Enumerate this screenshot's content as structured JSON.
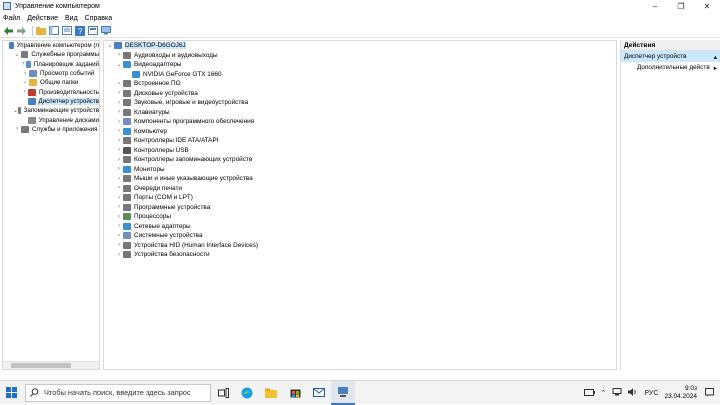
{
  "window": {
    "title": "Управление компьютером",
    "controls": [
      "–",
      "❐",
      "✕"
    ]
  },
  "menu": [
    "Файл",
    "Действие",
    "Вид",
    "Справка"
  ],
  "left_tree": [
    {
      "label": "Управление компьютером (л",
      "level": 0,
      "exp": "",
      "icon": "#4a7fbf"
    },
    {
      "label": "Служебные программы",
      "level": 1,
      "exp": "⌄",
      "icon": "#7a7a7a"
    },
    {
      "label": "Планировщик заданий",
      "level": 2,
      "exp": "›",
      "icon": "#5b8fd0"
    },
    {
      "label": "Просмотр событий",
      "level": 2,
      "exp": "›",
      "icon": "#6f8fbf"
    },
    {
      "label": "Общие папки",
      "level": 2,
      "exp": "›",
      "icon": "#e3b440"
    },
    {
      "label": "Производительность",
      "level": 2,
      "exp": "›",
      "icon": "#c0392b"
    },
    {
      "label": "Диспетчер устройств",
      "level": 2,
      "exp": "",
      "icon": "#4a7fbf",
      "selected": true
    },
    {
      "label": "Запоминающие устройств",
      "level": 1,
      "exp": "⌄",
      "icon": "#7a7a7a"
    },
    {
      "label": "Управление дисками",
      "level": 2,
      "exp": "",
      "icon": "#8a8a8a"
    },
    {
      "label": "Службы и приложения",
      "level": 1,
      "exp": "›",
      "icon": "#7a7a7a"
    }
  ],
  "device_tree": [
    {
      "label": "DESKTOP-D6GOJ6J",
      "level": 0,
      "exp": "⌄",
      "icon": "#4a7fbf",
      "selected": true
    },
    {
      "label": "Аудиовходы и аудиовыходы",
      "level": 1,
      "exp": "›",
      "icon": "#777777"
    },
    {
      "label": "Видеоадаптеры",
      "level": 1,
      "exp": "⌄",
      "icon": "#3a8fd0"
    },
    {
      "label": "NVIDIA GeForce GTX 1660",
      "level": 2,
      "exp": "",
      "icon": "#3a8fd0"
    },
    {
      "label": "Встроенное ПО",
      "level": 1,
      "exp": "›",
      "icon": "#777777"
    },
    {
      "label": "Дисковые устройства",
      "level": 1,
      "exp": "›",
      "icon": "#777777"
    },
    {
      "label": "Звуковые, игровые и видеоустройства",
      "level": 1,
      "exp": "›",
      "icon": "#777777"
    },
    {
      "label": "Клавиатуры",
      "level": 1,
      "exp": "›",
      "icon": "#777777"
    },
    {
      "label": "Компоненты программного обеспечения",
      "level": 1,
      "exp": "›",
      "icon": "#6f8fbf"
    },
    {
      "label": "Компьютер",
      "level": 1,
      "exp": "›",
      "icon": "#3a8fd0"
    },
    {
      "label": "Контроллеры IDE ATA/ATAPI",
      "level": 1,
      "exp": "›",
      "icon": "#777777"
    },
    {
      "label": "Контроллеры USB",
      "level": 1,
      "exp": "›",
      "icon": "#555555"
    },
    {
      "label": "Контроллеры запоминающих устройств",
      "level": 1,
      "exp": "›",
      "icon": "#777777"
    },
    {
      "label": "Мониторы",
      "level": 1,
      "exp": "›",
      "icon": "#3a8fd0"
    },
    {
      "label": "Мыши и иные указывающие устройства",
      "level": 1,
      "exp": "›",
      "icon": "#777777"
    },
    {
      "label": "Очереди печати",
      "level": 1,
      "exp": "›",
      "icon": "#777777"
    },
    {
      "label": "Порты (COM и LPT)",
      "level": 1,
      "exp": "›",
      "icon": "#777777"
    },
    {
      "label": "Программные устройства",
      "level": 1,
      "exp": "›",
      "icon": "#777777"
    },
    {
      "label": "Процессоры",
      "level": 1,
      "exp": "›",
      "icon": "#5a8f5a"
    },
    {
      "label": "Сетевые адаптеры",
      "level": 1,
      "exp": "›",
      "icon": "#3a8fd0"
    },
    {
      "label": "Системные устройства",
      "level": 1,
      "exp": "›",
      "icon": "#6f8fbf"
    },
    {
      "label": "Устройства HID (Human Interface Devices)",
      "level": 1,
      "exp": "›",
      "icon": "#777777"
    },
    {
      "label": "Устройства безопасности",
      "level": 1,
      "exp": "›",
      "icon": "#777777"
    }
  ],
  "actions": {
    "header": "Действия",
    "section": "Диспетчер устройств",
    "item": "Дополнительные действ"
  },
  "taskbar": {
    "search_placeholder": "Чтобы начать поиск, введите здесь запрос",
    "lang": "РУС",
    "time": "9:0з",
    "date": "23.04.2024"
  },
  "colors": {
    "selection": "#cce8ff",
    "accent": "#3a78c8",
    "taskbar": "#f3f3f3"
  }
}
